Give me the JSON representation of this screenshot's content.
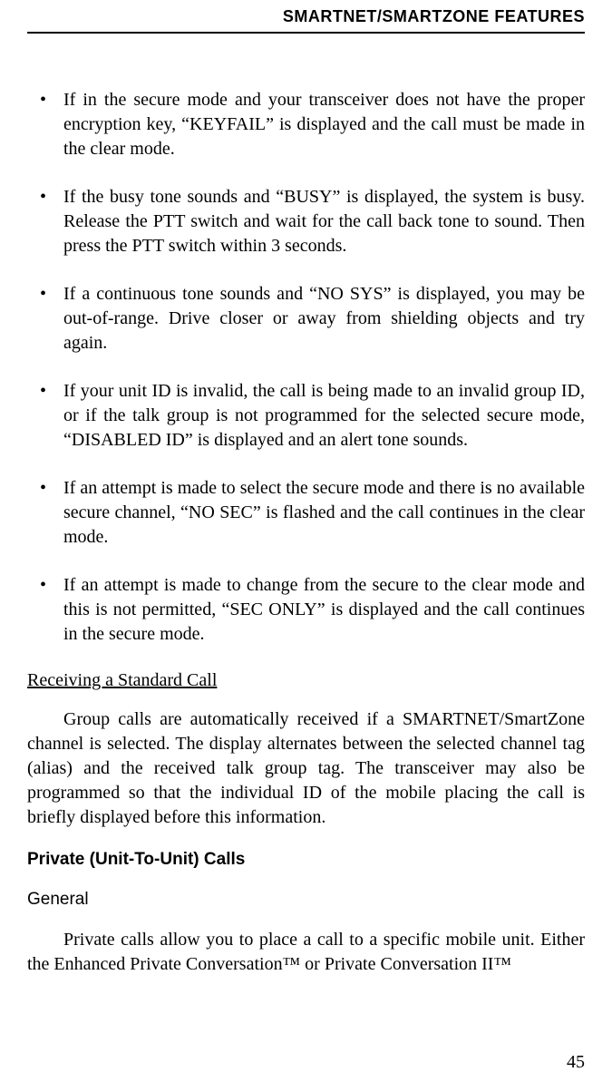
{
  "header": {
    "title": "SMARTNET/SMARTZONE FEATURES"
  },
  "bullets": [
    "If in the secure mode and your transceiver does not have the proper encryption key, “KEYFAIL” is displayed and the call must be made in the clear mode.",
    "If the busy tone sounds and “BUSY” is displayed, the system is busy. Release the PTT switch and wait for the call back tone to sound. Then press the PTT switch within 3 seconds.",
    "If a continuous tone sounds and “NO SYS” is displayed, you may be out-of-range. Drive closer or away from shielding objects and try again.",
    "If your unit ID is invalid, the call is being made to an invalid group ID, or if the talk group is not programmed for the selected secure mode, “DISABLED ID” is displayed and an alert tone sounds.",
    "If an attempt is made to select the secure mode and there is no available secure channel, “NO SEC” is flashed and the call continues in the clear mode.",
    "If an attempt is made to change from the secure to the clear mode and this is not permitted, “SEC ONLY” is displayed and the call continues in the secure mode."
  ],
  "sections": {
    "receiving": {
      "heading": "Receiving a Standard Call",
      "paragraph": "Group calls are automatically received if a SMARTNET/SmartZone channel is selected. The display alternates between the selected channel tag (alias) and the received talk group tag. The transceiver may also be programmed so that the individual ID of the mobile placing the call is briefly displayed before this information."
    },
    "private": {
      "heading": "Private (Unit-To-Unit) Calls",
      "subheading": "General",
      "paragraph": "Private calls allow you to place a call to a specific mobile unit. Either the Enhanced Private Conversation™ or Private Conversation II™"
    }
  },
  "pageNumber": "45"
}
